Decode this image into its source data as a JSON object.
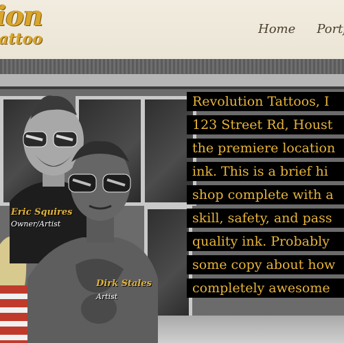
{
  "brand": {
    "logo_main": "ion",
    "logo_sub": "attoo"
  },
  "nav": {
    "items": [
      {
        "label": "Home"
      },
      {
        "label": "Portf"
      }
    ]
  },
  "artists": [
    {
      "name": "Eric Squires",
      "role": "Owner/Artist"
    },
    {
      "name": "Dirk Stales",
      "role": "Artist"
    }
  ],
  "intro": {
    "lines": [
      "Revolution Tattoos, I",
      "123 Street Rd, Houst",
      "the premiere location",
      "ink. This is a brief hi",
      "shop complete with a",
      "skill, safety, and pass",
      "quality ink. Probably",
      "some copy about how",
      "completely awesome"
    ]
  },
  "colors": {
    "accent_gold": "#e2b33a",
    "copy_background": "#000000",
    "header_background": "#efe9dc",
    "nav_text": "#4a3d2c"
  }
}
